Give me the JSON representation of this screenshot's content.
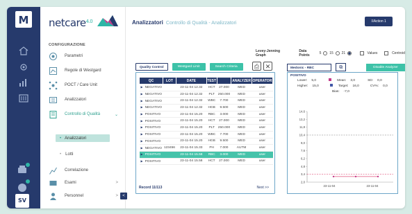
{
  "app": {
    "rail_logo": "M",
    "brand": "netcare",
    "brand_version": "4.0",
    "section_title": "CONFIGURAZIONE"
  },
  "rail_badges": [
    {
      "icon": "printer-icon",
      "badge": "1"
    },
    {
      "icon": "flask-icon",
      "badge": "2"
    },
    {
      "icon": "sv-icon",
      "label": "SV"
    }
  ],
  "sidebar": {
    "items": [
      {
        "label": "Parametri",
        "icon": "parameters-icon"
      },
      {
        "label": "Regole di Westgard",
        "icon": "rules-icon"
      },
      {
        "label": "POCT / Care Unit",
        "icon": "poct-icon"
      },
      {
        "label": "Analizzatori",
        "icon": "analyzer-icon"
      },
      {
        "label": "Controllo di Qualità",
        "icon": "quality-icon",
        "active": true
      },
      {
        "label": "Analizzatori",
        "sub": true,
        "selected": true
      },
      {
        "label": "Lotti",
        "sub": true
      },
      {
        "label": "Correlazione",
        "icon": "correlation-icon"
      },
      {
        "label": "Esami",
        "icon": "exams-icon",
        "chevron": ">"
      },
      {
        "label": "Personnel",
        "icon": "personnel-icon",
        "chevron": ">"
      }
    ]
  },
  "header": {
    "title": "Analizzatori",
    "subtitle": "Controllo di Qualità - Analizzatori",
    "action": "Action 1"
  },
  "options": {
    "levey": "Levey-Jenning Graph",
    "datapoints": "Data Points",
    "dp": [
      "5",
      "15",
      "21"
    ],
    "dp_selected": "21",
    "values": "Values",
    "centroid": "Centroid"
  },
  "tabs": [
    "Quality Control",
    "Westgard Limit",
    "Search Criteria"
  ],
  "table": {
    "columns": [
      "QC",
      "LOT",
      "DATE",
      "TEST",
      "ANALYZER",
      "OPERATOR"
    ],
    "extra_col": "",
    "rows": [
      [
        "NEGATIVO",
        "",
        "23-11-04 12.32",
        "HCT",
        "27.000",
        "MED",
        "user"
      ],
      [
        "NEGATIVO",
        "",
        "23-11-04 12.32",
        "PLT",
        "250.000",
        "MED",
        "user"
      ],
      [
        "NEGATIVO",
        "",
        "23-11-04 12.32",
        "WBC",
        "7.700",
        "MED",
        "user"
      ],
      [
        "NEGATIVO",
        "",
        "23-11-04 12.32",
        "HGB",
        "9.500",
        "MED",
        "user"
      ],
      [
        "POSITIVO",
        "",
        "23-11-04 15.20",
        "RBC",
        "3.000",
        "MED",
        "user"
      ],
      [
        "POSITIVO",
        "",
        "23-11-04 15.20",
        "HCT",
        "27.000",
        "MED",
        "user"
      ],
      [
        "POSITIVO",
        "",
        "23-11-04 15.20",
        "PLT",
        "250.000",
        "MED",
        "user"
      ],
      [
        "POSITIVO",
        "",
        "23-11-04 15.20",
        "WBC",
        "7.700",
        "MED",
        "user"
      ],
      [
        "POSITIVO",
        "",
        "23-11-04 15.20",
        "HGB",
        "9.500",
        "MED",
        "user"
      ],
      [
        "NEGATIVO",
        "123456",
        "23-11-04 15.33",
        "PH",
        "7.000",
        "AUTM",
        "user"
      ],
      [
        "POSITIVO",
        "",
        "23-11-04 15.58",
        "RBC",
        "3.000",
        "MED",
        "user"
      ],
      [
        "POSITIVO",
        "",
        "23-11-04 15.58",
        "HCT",
        "27.000",
        "MED",
        "user"
      ]
    ],
    "selected_row": 10,
    "record": "Record 11/113",
    "next": "Next >>"
  },
  "chart_panel": {
    "tab": "Medonic - RBC POSITIVO",
    "button": "Disable Analyzer",
    "stats": {
      "lower_l": "Lower:",
      "lower": "5,0",
      "mean_l": "Mean:",
      "mean": "3,0",
      "sd_l": "SD:",
      "sd": "0,0",
      "higher_l": "Higher:",
      "higher": "15,0",
      "target_l": "Target:",
      "target": "16,0",
      "cv_l": "CV%:",
      "cv": "0,0",
      "bias_l": "Bias:",
      "bias": "-7,0"
    }
  },
  "chart_data": {
    "type": "line",
    "x_ticks": [
      "23-11-04",
      "23-11-04"
    ],
    "ylim": [
      2.0,
      14.6
    ],
    "y_ticks": [
      "14,6",
      "13,2",
      "11,8",
      "10,4",
      "9,0",
      "7,6",
      "6,2",
      "4,8",
      "3,4",
      "2,0"
    ],
    "series": [
      {
        "values": [
          3.0,
          3.0,
          3.0
        ]
      }
    ],
    "reference_lines": [
      {
        "value": 10.4,
        "color": "#7a7a7a"
      },
      {
        "value": 3.4,
        "color": "#e0507a"
      }
    ],
    "colors": {
      "mean": "#c23b8a",
      "target": "#4258a8",
      "line": "#e0507a"
    }
  },
  "colors": {
    "navy": "#263a6c",
    "teal": "#3dc2a8"
  }
}
